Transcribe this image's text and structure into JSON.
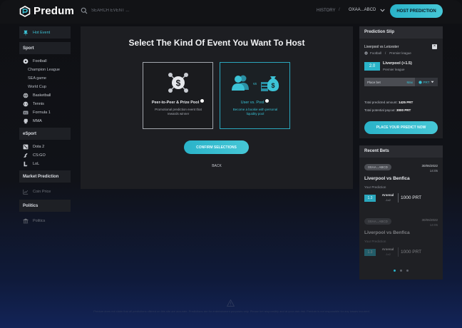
{
  "header": {
    "brand": "Predum",
    "search_placeholder": "SEARCH EVENT ...",
    "history": "HISTORY",
    "separator": "/",
    "username": "OXAA...ABCD",
    "host_button": "HOST PREDICTION"
  },
  "sidebar": {
    "hot_event": "Hot Event",
    "sections": {
      "sport": "Sport",
      "esport": "eSport",
      "market": "Market Prediction",
      "politics": "Politics"
    },
    "sport_items": {
      "football": "Football",
      "champion_league": "Champion League",
      "sea_game": "SEA game",
      "world_cup": "World Cup",
      "basketball": "Basketball",
      "tennis": "Tennis",
      "formula1": "Formula 1",
      "mma": "MMA"
    },
    "esport_items": {
      "dota2": "Dota 2",
      "csgo": "CS:GO",
      "lol": "LoL"
    },
    "coin_price": "Coin Price",
    "politics_item": "Politics"
  },
  "main": {
    "title": "Select The Kind Of Event You Want To Host",
    "cards": {
      "p2p": {
        "name": "Peer-to-Peer & Prize Pool",
        "desc": "Promotional prediction event that rewards winner"
      },
      "pool": {
        "name": "User vs. Pool",
        "vs": "vs",
        "desc": "Become a bookie with personal liquidity pool"
      }
    },
    "confirm": "CONFIRM SELECTIONS",
    "back": "BACK"
  },
  "slip": {
    "title": "Prediction Slip",
    "match": "Liverpool vs Leicester",
    "sport": "Football",
    "league_sep": "/",
    "league": "Premier league",
    "odds": "2.0",
    "pick": "Liverpool (+1.5)",
    "pick_league": "Premier league",
    "bet_placeholder": "Place bet",
    "max": "Max",
    "currency": "PRT",
    "predicted_label": "Total predicted amount:",
    "predicted_value": "1425 PRT",
    "payout_label": "Total potential payout:",
    "payout_value": "3000 PRT",
    "place_button": "PLACE YOUR PREDICT NOW"
  },
  "recent": {
    "title": "Recent Bets",
    "bets": [
      {
        "user": "0XAA...ABCD",
        "date": "30/06/2022",
        "time": "14:05",
        "match": "Liverpool vs Benfica",
        "label": "Your Prediction",
        "odd": "1.3",
        "team": "Arsenal",
        "handicap": "-1x2",
        "amount": "1000 PRT"
      },
      {
        "user": "0XAA...ABCD",
        "date": "30/06/2022",
        "time": "14:05",
        "match": "Liverpool vs Benfica",
        "label": "Your Prediction",
        "odd": "1.3",
        "team": "Arsenal",
        "handicap": "-1x2",
        "amount": "1000 PRT"
      }
    ]
  },
  "footer": {
    "disclaimer": "Predum does not claim that all predictions offered on this site are accurate. Predictions are for entertainment purposes only. Please bet responsibly and at your own risk. Predum is not responsible for any losses incurred."
  },
  "colors": {
    "accent": "#2ab3c9",
    "background": "#101218",
    "panel": "#1d1e22"
  }
}
